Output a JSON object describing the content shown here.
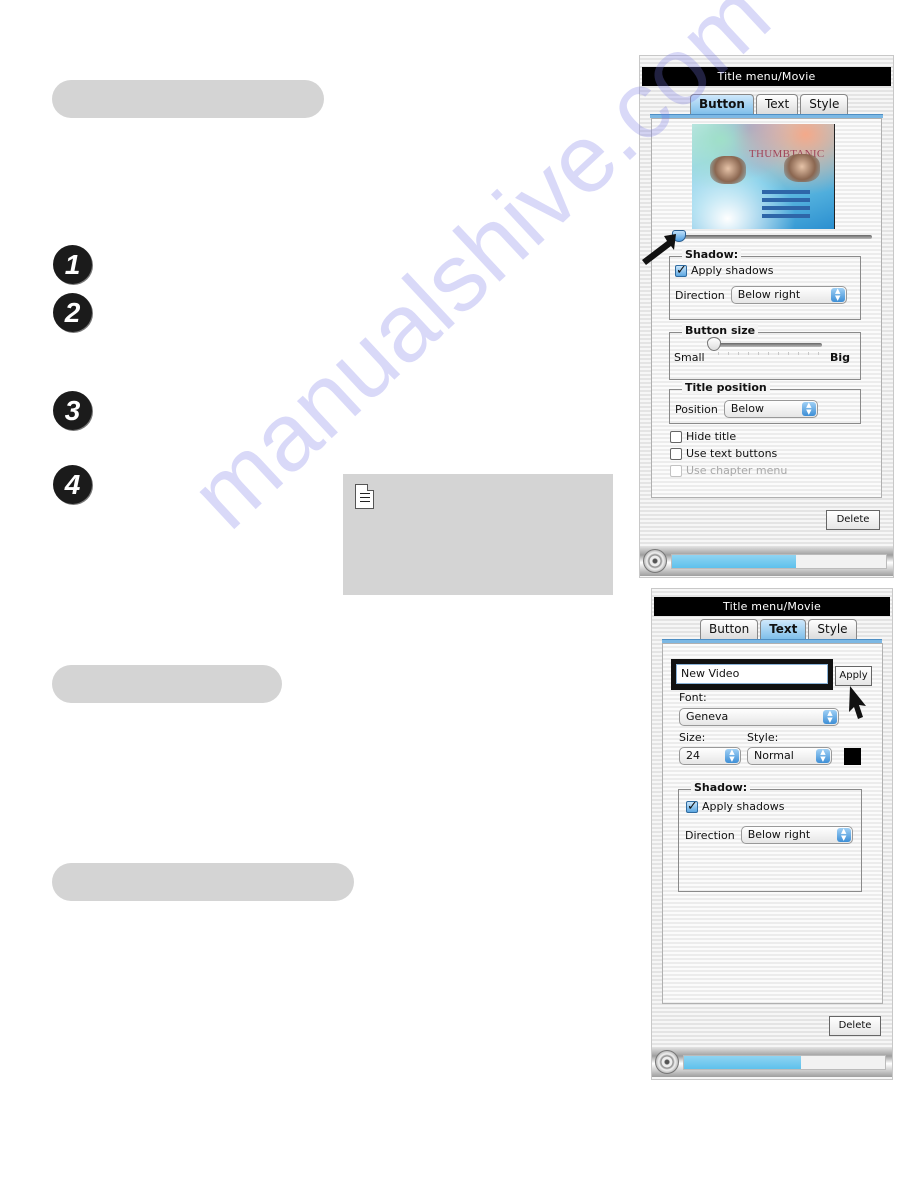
{
  "document": {
    "section_headers": [
      "",
      "",
      ""
    ],
    "steps": [
      "1",
      "2",
      "3",
      "4"
    ],
    "note_icon": "note-icon",
    "watermark": "manualshive.com"
  },
  "panel_button": {
    "window_title": "Title menu/Movie",
    "tabs": [
      {
        "label": "Button",
        "active": true
      },
      {
        "label": "Text",
        "active": false
      },
      {
        "label": "Style",
        "active": false
      }
    ],
    "thumbnail": {
      "title_text": "THUMBTANIC"
    },
    "thumbnail_slider_position": 0,
    "shadow": {
      "group_label": "Shadow:",
      "apply_label": "Apply shadows",
      "apply_checked": true,
      "direction_label": "Direction",
      "direction_value": "Below right"
    },
    "button_size": {
      "group_label": "Button size",
      "min_label": "Small",
      "max_label": "Big",
      "value": 0
    },
    "title_position": {
      "group_label": "Title position",
      "position_label": "Position",
      "position_value": "Below"
    },
    "checkboxes": [
      {
        "label": "Hide title",
        "checked": false,
        "enabled": true
      },
      {
        "label": "Use text buttons",
        "checked": false,
        "enabled": true
      },
      {
        "label": "Use chapter menu",
        "checked": false,
        "enabled": false
      }
    ],
    "delete_label": "Delete",
    "progress_percent": 58
  },
  "panel_text": {
    "window_title": "Title menu/Movie",
    "tabs": [
      {
        "label": "Button",
        "active": false
      },
      {
        "label": "Text",
        "active": true
      },
      {
        "label": "Style",
        "active": false
      }
    ],
    "text_field_value": "New Video",
    "apply_label": "Apply",
    "font_label": "Font:",
    "font_value": "Geneva",
    "size_label": "Size:",
    "size_value": "24",
    "style_label": "Style:",
    "style_value": "Normal",
    "text_color": "#000000",
    "shadow": {
      "group_label": "Shadow:",
      "apply_label": "Apply shadows",
      "apply_checked": true,
      "direction_label": "Direction",
      "direction_value": "Below right"
    },
    "delete_label": "Delete",
    "progress_percent": 58
  },
  "colors": {
    "accent_blue": "#5ec1ec",
    "tab_active": "#7fbfea",
    "pill_gray": "#d4d4d4",
    "step_black": "#1b1b1b"
  }
}
